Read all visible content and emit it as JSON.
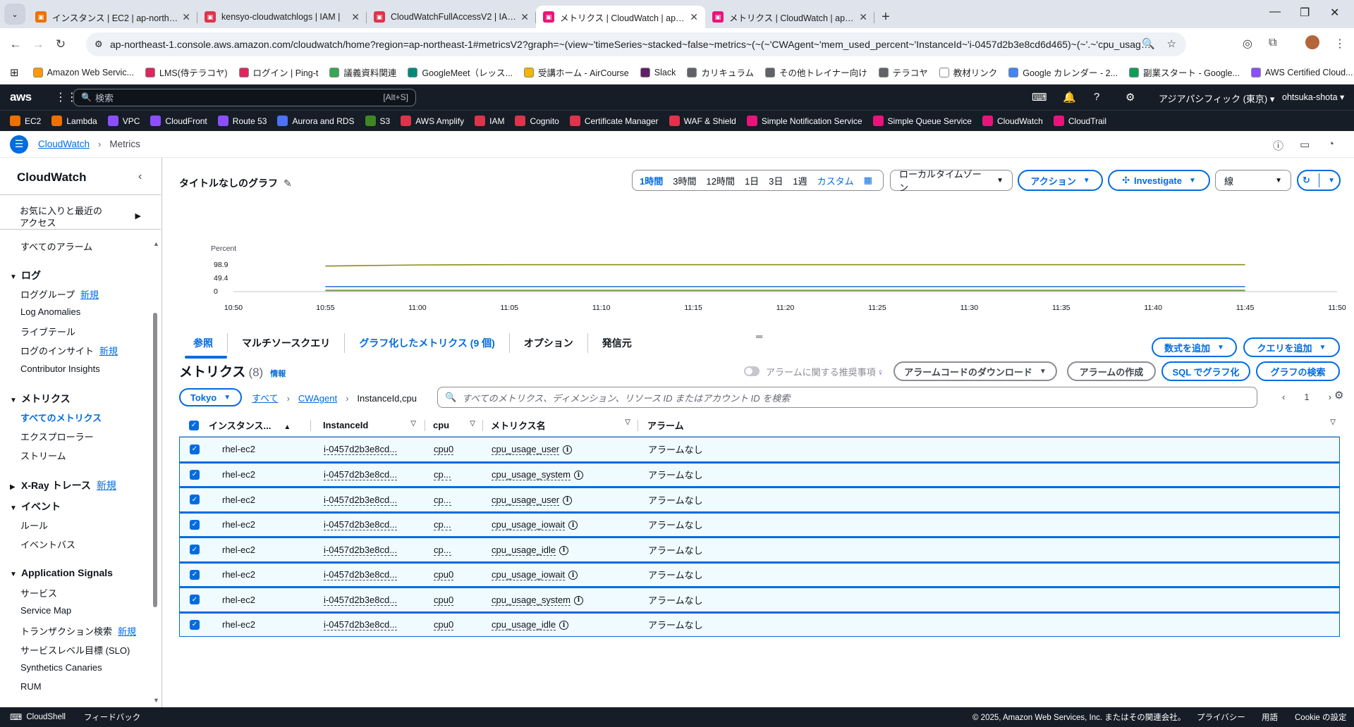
{
  "browser": {
    "tabs": [
      {
        "title": "インスタンス | EC2 | ap-northeast-",
        "color": "#ed7100",
        "active": false
      },
      {
        "title": "kensyo-cloudwatchlogs | IAM |",
        "color": "#dd344c",
        "active": false
      },
      {
        "title": "CloudWatchFullAccessV2 | IAM |",
        "color": "#dd344c",
        "active": false
      },
      {
        "title": "メトリクス | CloudWatch | ap-nort",
        "color": "#e7157b",
        "active": true
      },
      {
        "title": "メトリクス | CloudWatch | ap-nort",
        "color": "#e7157b",
        "active": false
      }
    ],
    "url": "ap-northeast-1.console.aws.amazon.com/cloudwatch/home?region=ap-northeast-1#metricsV2?graph=~(view~'timeSeries~stacked~false~metrics~(~(~'CWAgent~'mem_used_percent~'InstanceId~'i-0457d2b3e8cd6d465)~(~'.~'cpu_usage_user...",
    "bookmarks": [
      {
        "label": "Amazon Web Servic...",
        "color": "#ff9900"
      },
      {
        "label": "LMS(侍テラコヤ)",
        "color": "#e0245e"
      },
      {
        "label": "ログイン | Ping-t",
        "color": "#e0245e"
      },
      {
        "label": "議義資料関連",
        "color": "#34a853"
      },
      {
        "label": "GoogleMeet（レッス...",
        "color": "#00897b"
      },
      {
        "label": "受講ホーム - AirCourse",
        "color": "#f4b400"
      },
      {
        "label": "Slack",
        "color": "#611f69"
      },
      {
        "label": "カリキュラム",
        "color": "#5f6368"
      },
      {
        "label": "その他トレイナー向け",
        "color": "#5f6368"
      },
      {
        "label": "テラコヤ",
        "color": "#5f6368"
      },
      {
        "label": "教材リンク",
        "color": "#ffffff"
      },
      {
        "label": "Google カレンダー - 2...",
        "color": "#4285f4"
      },
      {
        "label": "副業スタート - Google...",
        "color": "#0f9d58"
      },
      {
        "label": "AWS Certified Cloud...",
        "color": "#8c4fff"
      }
    ]
  },
  "aws_header": {
    "logo": "aws",
    "search_placeholder": "検索",
    "search_shortcut": "[Alt+S]",
    "region": "アジアパシフィック (東京) ▾",
    "account": "ohtsuka-shota ▾"
  },
  "favorites": [
    {
      "label": "EC2",
      "color": "#ed7100"
    },
    {
      "label": "Lambda",
      "color": "#ed7100"
    },
    {
      "label": "VPC",
      "color": "#8c4fff"
    },
    {
      "label": "CloudFront",
      "color": "#8c4fff"
    },
    {
      "label": "Route 53",
      "color": "#8c4fff"
    },
    {
      "label": "Aurora and RDS",
      "color": "#4d72f3"
    },
    {
      "label": "S3",
      "color": "#3f8624"
    },
    {
      "label": "AWS Amplify",
      "color": "#dd344c"
    },
    {
      "label": "IAM",
      "color": "#dd344c"
    },
    {
      "label": "Cognito",
      "color": "#dd344c"
    },
    {
      "label": "Certificate Manager",
      "color": "#dd344c"
    },
    {
      "label": "WAF & Shield",
      "color": "#dd344c"
    },
    {
      "label": "Simple Notification Service",
      "color": "#e7157b"
    },
    {
      "label": "Simple Queue Service",
      "color": "#e7157b"
    },
    {
      "label": "CloudWatch",
      "color": "#e7157b"
    },
    {
      "label": "CloudTrail",
      "color": "#e7157b"
    }
  ],
  "breadcrumb": {
    "root": "CloudWatch",
    "current": "Metrics"
  },
  "sidebar": {
    "title": "CloudWatch",
    "favorites": "お気に入りと最近の\nアクセス",
    "all_alarms": "すべてのアラーム",
    "logs_header": "ログ",
    "log_groups": "ロググループ",
    "log_anomalies": "Log Anomalies",
    "live_tail": "ライブテール",
    "log_insights": "ログのインサイト",
    "contributor": "Contributor Insights",
    "metrics_header": "メトリクス",
    "all_metrics": "すべてのメトリクス",
    "explorer": "エクスプローラー",
    "streams": "ストリーム",
    "xray_header": "X-Ray トレース",
    "events_header": "イベント",
    "rules": "ルール",
    "event_bus": "イベントバス",
    "appsignals_header": "Application Signals",
    "services": "サービス",
    "service_map": "Service Map",
    "txn_search": "トランザクション検索",
    "slo": "サービスレベル目標 (SLO)",
    "canaries": "Synthetics Canaries",
    "rum": "RUM",
    "new_badge": "新規"
  },
  "graph": {
    "title": "タイトルなしのグラフ",
    "time_ranges": [
      "1時間",
      "3時間",
      "12時間",
      "1日",
      "3日",
      "1週"
    ],
    "custom": "カスタム",
    "timezone": "ローカルタイムゾーン",
    "actions": "アクション",
    "investigate": "Investigate",
    "chart_type": "線"
  },
  "chart_data": {
    "type": "line",
    "ylabel": "Percent",
    "yticks": [
      0,
      49.4,
      98.9
    ],
    "xticks": [
      "10:50",
      "10:55",
      "11:00",
      "11:05",
      "11:10",
      "11:15",
      "11:20",
      "11:25",
      "11:30",
      "11:35",
      "11:40",
      "11:45",
      "11:50"
    ],
    "x_range": [
      "10:50",
      "11:50"
    ],
    "y_range": [
      0,
      98.9
    ],
    "series": [
      {
        "color": "#8c8c1c",
        "x": [
          "10:55",
          "11:00",
          "11:05",
          "11:45"
        ],
        "values": [
          92,
          96,
          97,
          97
        ]
      },
      {
        "color": "#3c78d8",
        "x": [
          "10:55",
          "11:45"
        ],
        "values": [
          16,
          16
        ]
      },
      {
        "color": "#b34747",
        "x": [
          "10:55",
          "11:45"
        ],
        "values": [
          2,
          2
        ]
      },
      {
        "color": "#6aa84f",
        "x": [
          "10:55",
          "11:45"
        ],
        "values": [
          1,
          1
        ]
      }
    ]
  },
  "tabs": {
    "browse": "参照",
    "multisource": "マルチソースクエリ",
    "graphed": "グラフ化したメトリクス (9 個)",
    "options": "オプション",
    "source": "発信元"
  },
  "buttons": {
    "add_math": "数式を追加",
    "add_query": "クエリを追加",
    "alarm_recommend": "アラームに関する推奨事項",
    "download_alarm_code": "アラームコードのダウンロード",
    "create_alarm": "アラームの作成",
    "graph_with_sql": "SQL でグラフ化",
    "graph_search": "グラフの検索"
  },
  "metrics": {
    "heading": "メトリクス",
    "count": "(8)",
    "info": "情報",
    "region": "Tokyo",
    "crumb_all": "すべて",
    "crumb_ns": "CWAgent",
    "crumb_dim": "InstanceId,cpu",
    "search_placeholder": "すべてのメトリクス、ディメンション、リソース ID またはアカウント ID を検索",
    "page": "1",
    "columns": [
      "インスタンス...",
      "InstanceId",
      "cpu",
      "メトリクス名",
      "アラーム"
    ],
    "rows": [
      {
        "name": "rhel-ec2",
        "id": "i-0457d2b3e8cd...",
        "cpu": "cpu0",
        "metric": "cpu_usage_user",
        "alarm": "アラームなし"
      },
      {
        "name": "rhel-ec2",
        "id": "i-0457d2b3e8cd...",
        "cpu": "cp...",
        "metric": "cpu_usage_system",
        "alarm": "アラームなし"
      },
      {
        "name": "rhel-ec2",
        "id": "i-0457d2b3e8cd...",
        "cpu": "cp...",
        "metric": "cpu_usage_user",
        "alarm": "アラームなし"
      },
      {
        "name": "rhel-ec2",
        "id": "i-0457d2b3e8cd...",
        "cpu": "cp...",
        "metric": "cpu_usage_iowait",
        "alarm": "アラームなし"
      },
      {
        "name": "rhel-ec2",
        "id": "i-0457d2b3e8cd...",
        "cpu": "cp...",
        "metric": "cpu_usage_idle",
        "alarm": "アラームなし"
      },
      {
        "name": "rhel-ec2",
        "id": "i-0457d2b3e8cd...",
        "cpu": "cpu0",
        "metric": "cpu_usage_iowait",
        "alarm": "アラームなし"
      },
      {
        "name": "rhel-ec2",
        "id": "i-0457d2b3e8cd...",
        "cpu": "cpu0",
        "metric": "cpu_usage_system",
        "alarm": "アラームなし"
      },
      {
        "name": "rhel-ec2",
        "id": "i-0457d2b3e8cd...",
        "cpu": "cpu0",
        "metric": "cpu_usage_idle",
        "alarm": "アラームなし"
      }
    ]
  },
  "footer": {
    "cloudshell": "CloudShell",
    "feedback": "フィードバック",
    "copyright": "© 2025, Amazon Web Services, Inc. またはその関連会社。",
    "privacy": "プライバシー",
    "terms": "用語",
    "cookie": "Cookie の設定"
  }
}
